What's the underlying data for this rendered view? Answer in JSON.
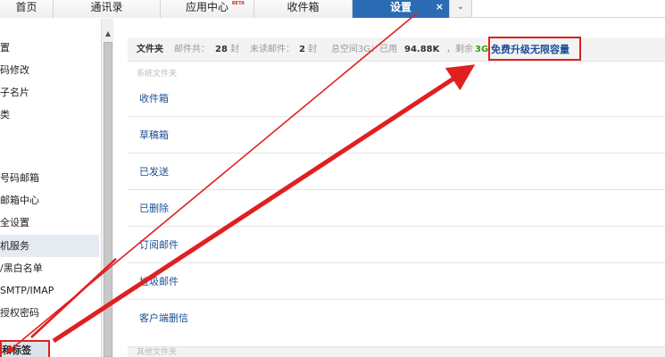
{
  "tabs": [
    {
      "label": "首页"
    },
    {
      "label": "通讯录"
    },
    {
      "label": "应用中心",
      "badge": "BETA"
    },
    {
      "label": "收件箱"
    },
    {
      "label": "设置",
      "close": "×"
    }
  ],
  "tab_dropdown": "⌄",
  "sidebar": {
    "items": [
      {
        "label": "置"
      },
      {
        "label": "码修改"
      },
      {
        "label": "子名片"
      },
      {
        "label": "类"
      },
      {
        "label": "号码邮箱"
      },
      {
        "label": "邮箱中心"
      },
      {
        "label": "全设置"
      },
      {
        "label": "机服务"
      },
      {
        "label": "/黑白名单"
      },
      {
        "label": "SMTP/IMAP"
      },
      {
        "label": "授权密码"
      },
      {
        "label": "和标签"
      }
    ],
    "scroll_up": "▲"
  },
  "infobar": {
    "folder_label": "文件夹",
    "mail_total_label": "邮件共：",
    "mail_total": "28",
    "mail_total_unit": "封",
    "unread_label": "未读邮件：",
    "unread": "2",
    "unread_unit": "封",
    "space_label": "总空间3G：已用",
    "used": "94.88K",
    "remaining_label": "，剩余",
    "remaining": "3G",
    "upgrade_link": "免费升级无限容量"
  },
  "system_folders_header": "系统文件夹",
  "folders": [
    {
      "label": "收件箱"
    },
    {
      "label": "草稿箱"
    },
    {
      "label": "已发送"
    },
    {
      "label": "已删除"
    },
    {
      "label": "订阅邮件"
    },
    {
      "label": "垃圾邮件"
    },
    {
      "label": "客户端删信"
    }
  ],
  "other_folders_header": "其他文件夹",
  "colors": {
    "active_tab": "#2b6bb4",
    "annotation_red": "#e02020",
    "link_blue": "#1a4f95",
    "quota_green": "#3a9a1a"
  }
}
